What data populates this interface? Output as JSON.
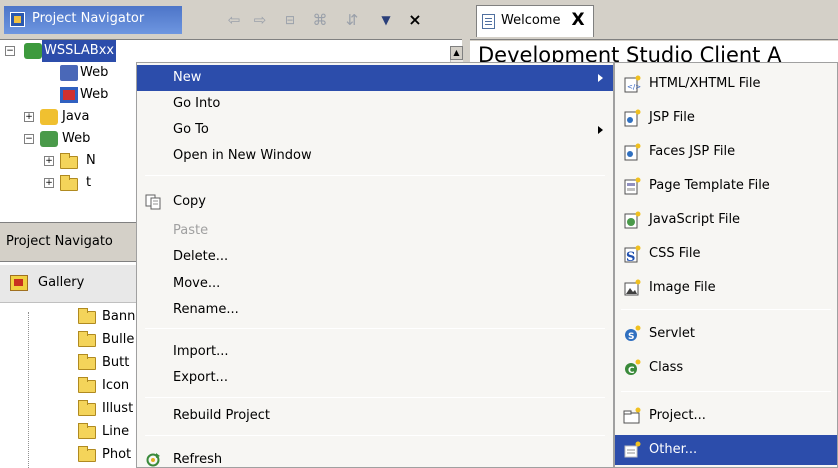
{
  "navigator": {
    "title": "Project Navigator",
    "toolbar": {
      "back_icon": "back-arrow-icon",
      "forward_icon": "forward-arrow-icon",
      "collapse_icon": "collapse-all-icon",
      "filter_icon": "filter-icon",
      "link_icon": "link-editor-icon",
      "menu_icon": "view-menu-icon",
      "close": "×"
    },
    "tree": [
      {
        "label": "WSSLABxx",
        "selected": true
      },
      {
        "label": "Web"
      },
      {
        "label": "Web"
      },
      {
        "label": "Java"
      },
      {
        "label": "Web"
      },
      {
        "label": "N"
      },
      {
        "label": "t"
      }
    ]
  },
  "lower_view": {
    "tab_label": "Project Navigato",
    "gallery_label": "Gallery",
    "folders": [
      "Bann",
      "Bulle",
      "Butt",
      "Icon",
      "Illust",
      "Line",
      "Phot"
    ]
  },
  "editor": {
    "tab_label": "Welcome",
    "close": "X",
    "heading": "Development Studio Client A"
  },
  "context_menu": {
    "items": [
      {
        "label": "New",
        "submenu": true,
        "highlighted": true
      },
      {
        "label": "Go Into"
      },
      {
        "label": "Go To",
        "submenu": true
      },
      {
        "label": "Open in New Window"
      },
      {
        "label": "Copy",
        "icon": "copy-icon"
      },
      {
        "label": "Paste",
        "disabled": true
      },
      {
        "label": "Delete..."
      },
      {
        "label": "Move..."
      },
      {
        "label": "Rename..."
      },
      {
        "label": "Import..."
      },
      {
        "label": "Export..."
      },
      {
        "label": "Rebuild Project"
      },
      {
        "label": "Refresh",
        "icon": "refresh-icon"
      }
    ]
  },
  "submenu": {
    "items": [
      {
        "label": "HTML/XHTML File",
        "icon": "html-file-icon"
      },
      {
        "label": "JSP File",
        "icon": "jsp-file-icon"
      },
      {
        "label": "Faces JSP File",
        "icon": "faces-jsp-icon"
      },
      {
        "label": "Page Template File",
        "icon": "page-template-icon"
      },
      {
        "label": "JavaScript File",
        "icon": "javascript-file-icon"
      },
      {
        "label": "CSS File",
        "icon": "css-file-icon"
      },
      {
        "label": "Image File",
        "icon": "image-file-icon"
      },
      {
        "label": "Servlet",
        "icon": "servlet-icon"
      },
      {
        "label": "Class",
        "icon": "class-icon"
      },
      {
        "label": "Project...",
        "icon": "project-icon"
      },
      {
        "label": "Other...",
        "icon": "other-wizard-icon",
        "highlighted": true
      }
    ]
  },
  "colors": {
    "selection": "#2c4dab",
    "title_gradient_start": "#4d75c8",
    "title_gradient_end": "#6e96e0",
    "chrome": "#d4d0c8",
    "menu_bg": "#f7f6f3"
  }
}
